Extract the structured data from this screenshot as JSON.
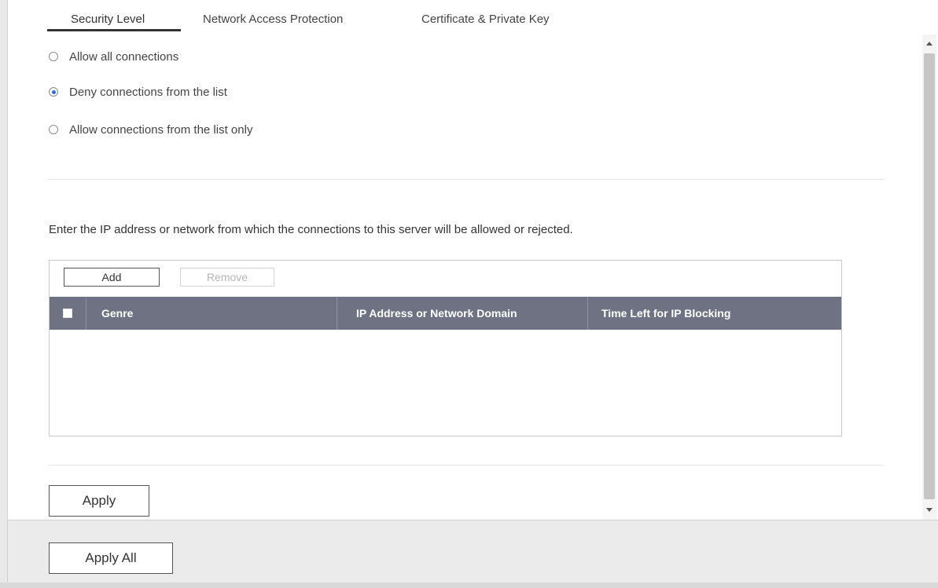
{
  "tabs": [
    {
      "label": "Security Level",
      "active": true
    },
    {
      "label": "Network Access Protection",
      "active": false
    },
    {
      "label": "Certificate & Private Key",
      "active": false
    }
  ],
  "security": {
    "options": [
      {
        "label": "Allow all connections",
        "checked": false
      },
      {
        "label": "Deny connections from the list",
        "checked": true
      },
      {
        "label": "Allow connections from the list only",
        "checked": false
      }
    ],
    "description": "Enter the IP address or network from which the connections to this server will be allowed or rejected."
  },
  "list_panel": {
    "add_label": "Add",
    "remove_label": "Remove",
    "columns": [
      "Genre",
      "IP Address or Network Domain",
      "Time Left for IP Blocking"
    ],
    "rows": []
  },
  "buttons": {
    "apply": "Apply",
    "apply_all": "Apply All"
  },
  "colors": {
    "table_header": "#6e7282",
    "radio_selected": "#2f6fd1"
  },
  "icons": {
    "scroll_up": "triangle-up",
    "scroll_down": "triangle-down"
  }
}
